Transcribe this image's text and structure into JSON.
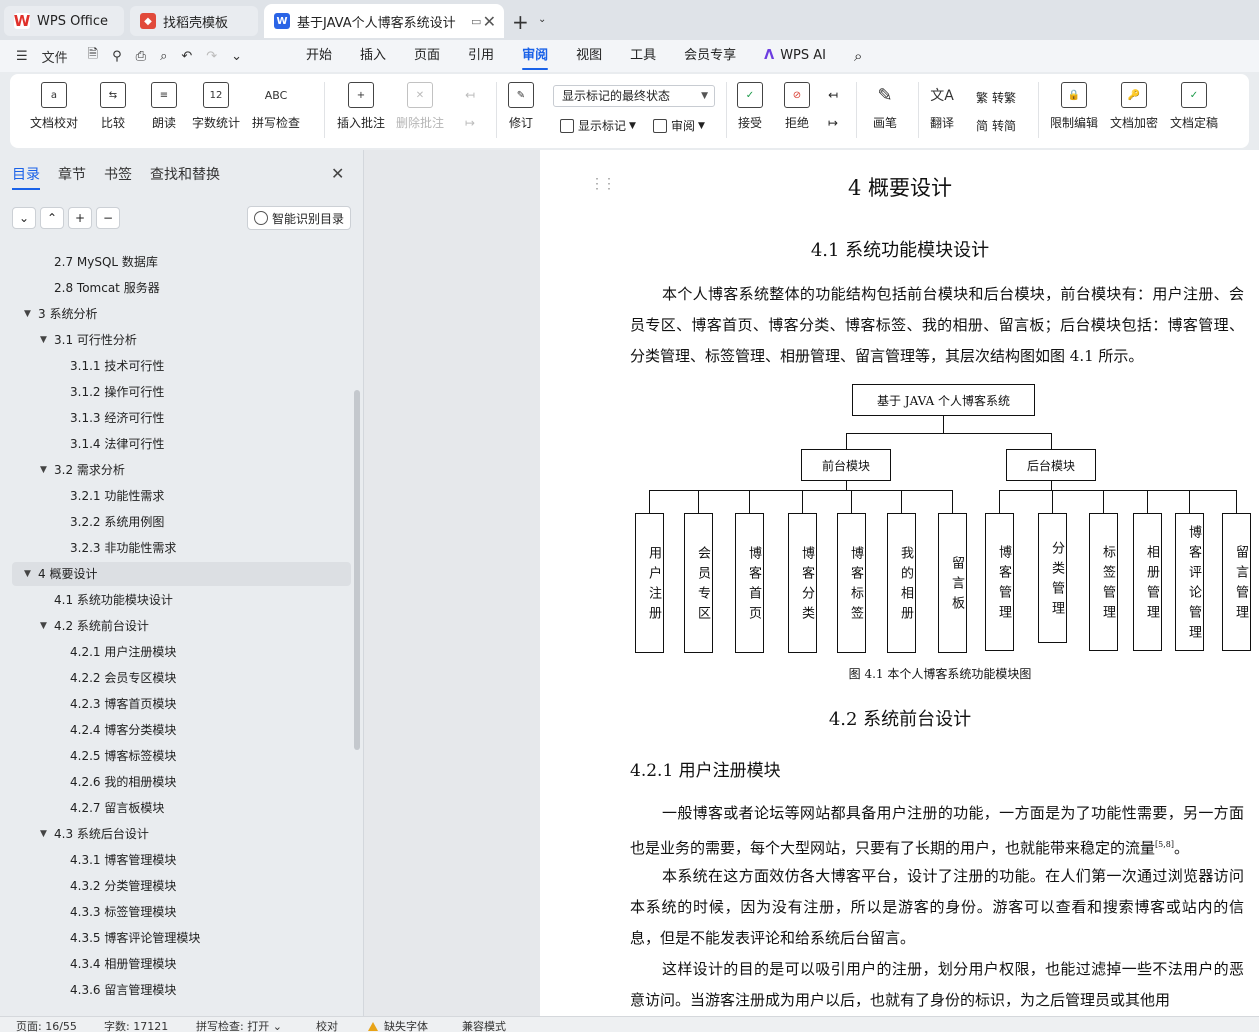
{
  "tabs": [
    {
      "label": "WPS Office"
    },
    {
      "label": "找稻壳模板"
    },
    {
      "label": "基于JAVA个人博客系统设计"
    }
  ],
  "menu": {
    "file_label": "文件",
    "tabs": [
      "开始",
      "插入",
      "页面",
      "引用",
      "审阅",
      "视图",
      "工具",
      "会员专享"
    ],
    "active_tab": "审阅",
    "ai_label": "WPS AI"
  },
  "ribbon": {
    "buttons": [
      "文档校对",
      "比较",
      "朗读",
      "字数统计",
      "拼写检查",
      "插入批注",
      "删除批注",
      "修订",
      "接受",
      "拒绝",
      "画笔",
      "翻译",
      "限制编辑",
      "文档加密",
      "文档定稿"
    ],
    "markup_select": "显示标记的最终状态",
    "show_markup": "显示标记",
    "review": "审阅",
    "to_traditional": "转繁",
    "to_simplified": "转简",
    "spell_icon_text": "ABC",
    "wordcount_icon_text": "12"
  },
  "sidebar": {
    "tabs": [
      "目录",
      "章节",
      "书签",
      "查找和替换"
    ],
    "smart_toc": "智能识别目录",
    "toc": [
      {
        "text": "2.7 MySQL 数据库",
        "level": 2,
        "caret": ""
      },
      {
        "text": "2.8 Tomcat 服务器",
        "level": 2,
        "caret": ""
      },
      {
        "text": "3  系统分析",
        "level": 1,
        "caret": "▼"
      },
      {
        "text": "3.1  可行性分析",
        "level": 2,
        "caret": "▼"
      },
      {
        "text": "3.1.1  技术可行性",
        "level": 3,
        "caret": ""
      },
      {
        "text": "3.1.2  操作可行性",
        "level": 3,
        "caret": ""
      },
      {
        "text": "3.1.3  经济可行性",
        "level": 3,
        "caret": ""
      },
      {
        "text": "3.1.4  法律可行性",
        "level": 3,
        "caret": ""
      },
      {
        "text": "3.2  需求分析",
        "level": 2,
        "caret": "▼"
      },
      {
        "text": "3.2.1  功能性需求",
        "level": 3,
        "caret": ""
      },
      {
        "text": "3.2.2  系统用例图",
        "level": 3,
        "caret": ""
      },
      {
        "text": "3.2.3  非功能性需求",
        "level": 3,
        "caret": ""
      },
      {
        "text": "4  概要设计",
        "level": 1,
        "caret": "▼"
      },
      {
        "text": "4.1  系统功能模块设计",
        "level": 2,
        "caret": ""
      },
      {
        "text": "4.2  系统前台设计",
        "level": 2,
        "caret": "▼"
      },
      {
        "text": "4.2.1  用户注册模块",
        "level": 3,
        "caret": ""
      },
      {
        "text": "4.2.2  会员专区模块",
        "level": 3,
        "caret": ""
      },
      {
        "text": "4.2.3  博客首页模块",
        "level": 3,
        "caret": ""
      },
      {
        "text": "4.2.4  博客分类模块",
        "level": 3,
        "caret": ""
      },
      {
        "text": "4.2.5  博客标签模块",
        "level": 3,
        "caret": ""
      },
      {
        "text": "4.2.6  我的相册模块",
        "level": 3,
        "caret": ""
      },
      {
        "text": "4.2.7  留言板模块",
        "level": 3,
        "caret": ""
      },
      {
        "text": "4.3  系统后台设计",
        "level": 2,
        "caret": "▼"
      },
      {
        "text": "4.3.1  博客管理模块",
        "level": 3,
        "caret": ""
      },
      {
        "text": "4.3.2  分类管理模块",
        "level": 3,
        "caret": ""
      },
      {
        "text": "4.3.3  标签管理模块",
        "level": 3,
        "caret": ""
      },
      {
        "text": "4.3.5  博客评论管理模块",
        "level": 3,
        "caret": ""
      },
      {
        "text": "4.3.4  相册管理模块",
        "level": 3,
        "caret": ""
      },
      {
        "text": "4.3.6  留言管理模块",
        "level": 3,
        "caret": ""
      }
    ],
    "selected_index": 12
  },
  "document": {
    "h1": "4  概要设计",
    "h2_1": "4.1  系统功能模块设计",
    "para1": "本个人博客系统整体的功能结构包括前台模块和后台模块，前台模块有：用户注册、会员专区、博客首页、博客分类、博客标签、我的相册、留言板；后台模块包括：博客管理、分类管理、标签管理、相册管理、留言管理等，其层次结构图如图 4.1 所示。",
    "chart": {
      "root": "基于 JAVA 个人博客系统",
      "front": "前台模块",
      "back": "后台模块",
      "front_items": [
        "用户注册",
        "会员专区",
        "博客首页",
        "博客分类",
        "博客标签",
        "我的相册",
        "留言板"
      ],
      "back_items": [
        "博客管理",
        "分类管理",
        "标签管理",
        "相册管理",
        "博客评论管理",
        "留言管理"
      ]
    },
    "caption": "图 4.1  本个人博客系统功能模块图",
    "h2_2": "4.2  系统前台设计",
    "h3_1": "4.2.1  用户注册模块",
    "para2": "一般博客或者论坛等网站都具备用户注册的功能，一方面是为了功能性需要，另一方面也是业务的需要，每个大型网站，只要有了长期的用户，也就能带来稳定的流量",
    "para2_ref": "[5,8]",
    "para2_end": "。",
    "para3": "本系统在这方面效仿各大博客平台，设计了注册的功能。在人们第一次通过浏览器访问本系统的时候，因为没有注册，所以是游客的身份。游客可以查看和搜索博客或站内的信息，但是不能发表评论和给系统后台留言。",
    "para4": "这样设计的目的是可以吸引用户的注册，划分用户权限，也能过滤掉一些不法用户的恶意访问。当游客注册成为用户以后，也就有了身份的标识，为之后管理员或其他用"
  },
  "status": {
    "page": "页面: 16/55",
    "words": "字数: 17121",
    "spell": "拼写检查: 打开",
    "proof": "校对",
    "missing_font": "缺失字体",
    "compat": "兼容模式"
  }
}
